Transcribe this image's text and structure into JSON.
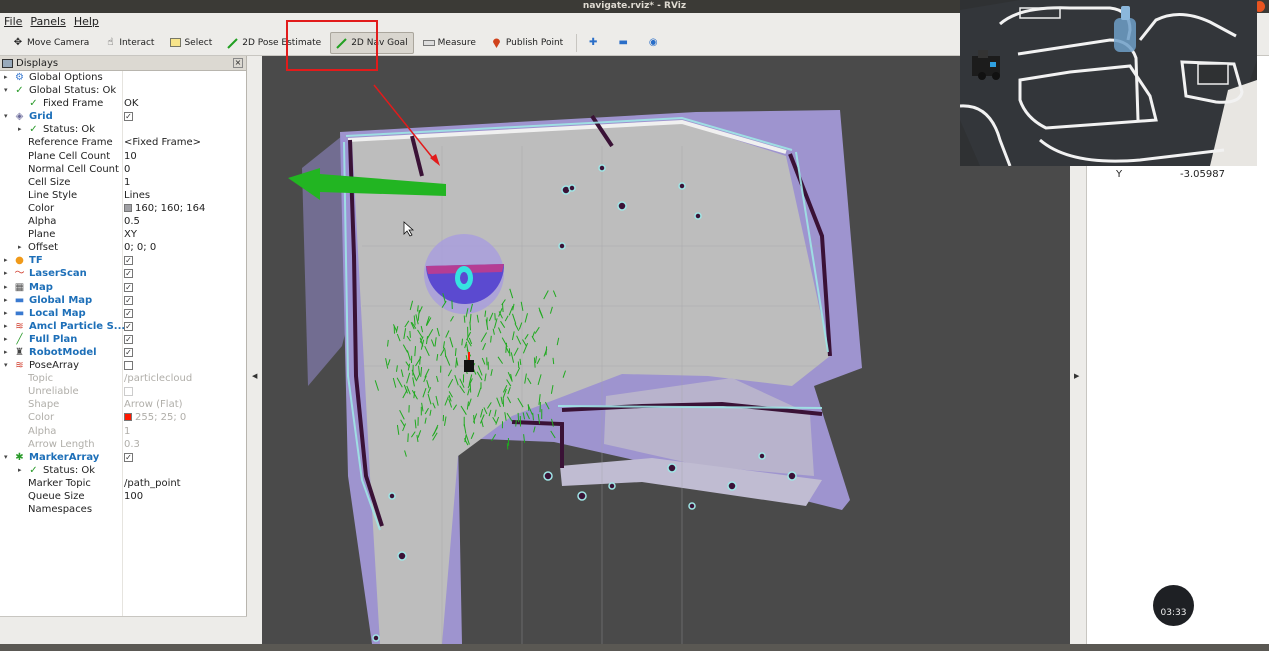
{
  "window": {
    "title": "navigate.rviz* - RViz"
  },
  "menubar": [
    "File",
    "Panels",
    "Help"
  ],
  "toolbar": {
    "tools": [
      {
        "label": "Move Camera",
        "icon": "move-camera-icon"
      },
      {
        "label": "Interact",
        "icon": "hand-icon"
      },
      {
        "label": "Select",
        "icon": "select-box-icon"
      },
      {
        "label": "2D Pose Estimate",
        "icon": "green-arrow-icon"
      },
      {
        "label": "2D Nav Goal",
        "icon": "green-arrow-icon",
        "active": true
      },
      {
        "label": "Measure",
        "icon": "ruler-icon"
      },
      {
        "label": "Publish Point",
        "icon": "map-pin-icon"
      }
    ]
  },
  "displays": {
    "title": "Displays",
    "rows": [
      {
        "key": "Global Options",
        "value": ""
      },
      {
        "key": "Global Status: Ok",
        "value": ""
      },
      {
        "key": "Fixed Frame",
        "value": "OK"
      },
      {
        "key": "Grid",
        "value": ""
      },
      {
        "key": "Status: Ok",
        "value": ""
      },
      {
        "key": "Reference Frame",
        "value": "<Fixed Frame>"
      },
      {
        "key": "Plane Cell Count",
        "value": "10"
      },
      {
        "key": "Normal Cell Count",
        "value": "0"
      },
      {
        "key": "Cell Size",
        "value": "1"
      },
      {
        "key": "Line Style",
        "value": "Lines"
      },
      {
        "key": "Color",
        "value": "160; 160; 164"
      },
      {
        "key": "Alpha",
        "value": "0.5"
      },
      {
        "key": "Plane",
        "value": "XY"
      },
      {
        "key": "Offset",
        "value": "0; 0; 0"
      },
      {
        "key": "TF",
        "value": ""
      },
      {
        "key": "LaserScan",
        "value": ""
      },
      {
        "key": "Map",
        "value": ""
      },
      {
        "key": "Global Map",
        "value": ""
      },
      {
        "key": "Local Map",
        "value": ""
      },
      {
        "key": "Amcl Particle S...",
        "value": ""
      },
      {
        "key": "Full Plan",
        "value": ""
      },
      {
        "key": "RobotModel",
        "value": ""
      },
      {
        "key": "PoseArray",
        "value": ""
      },
      {
        "key": "Topic",
        "value": "/particlecloud"
      },
      {
        "key": "Unreliable",
        "value": ""
      },
      {
        "key": "Shape",
        "value": "Arrow (Flat)"
      },
      {
        "key": "Color",
        "value": "255; 25; 0"
      },
      {
        "key": "Alpha",
        "value": "1"
      },
      {
        "key": "Arrow Length",
        "value": "0.3"
      },
      {
        "key": "MarkerArray",
        "value": ""
      },
      {
        "key": "Status: Ok",
        "value": ""
      },
      {
        "key": "Marker Topic",
        "value": "/path_point"
      },
      {
        "key": "Queue Size",
        "value": "100"
      },
      {
        "key": "Namespaces",
        "value": ""
      }
    ]
  },
  "right_panel": {
    "field_label": "Y",
    "field_value": "-3.05987"
  },
  "timer": "03:33",
  "colors": {
    "grid_color": "#a0a0a4",
    "pose_color": "#ff1900",
    "accent_blue": "#1d6fb8",
    "highlight_red": "#e21b1b",
    "goal_arrow_green": "#22b522"
  }
}
